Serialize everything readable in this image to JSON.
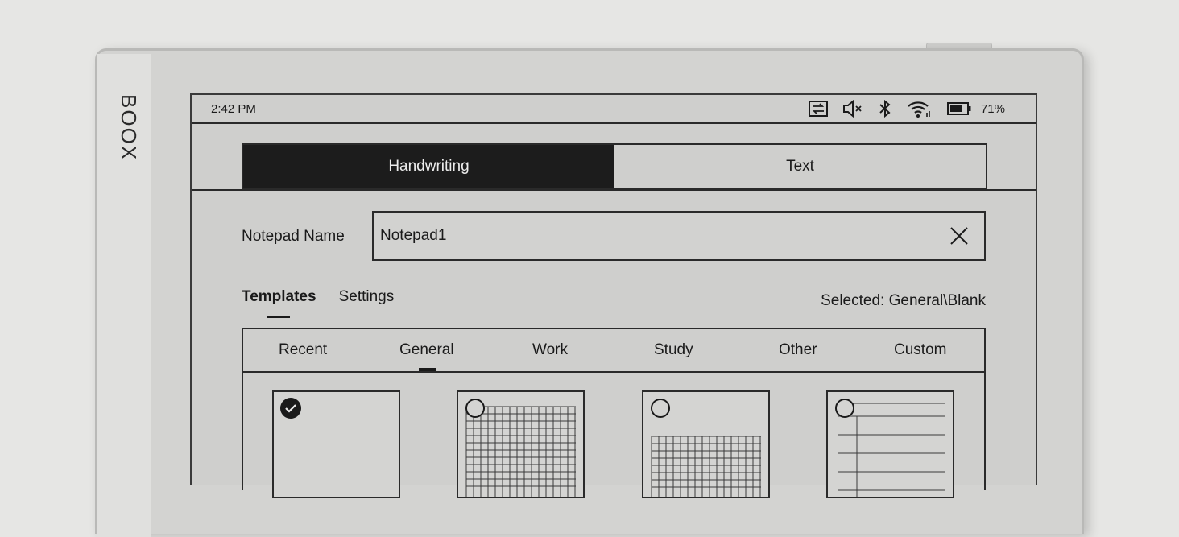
{
  "device": {
    "brand": "BOOX"
  },
  "status_bar": {
    "time": "2:42 PM",
    "icons": [
      "screen-refresh-icon",
      "speaker-muted-icon",
      "bluetooth-icon",
      "wifi-icon",
      "battery-icon"
    ],
    "battery_percent": "71%"
  },
  "mode_tabs": [
    {
      "label": "Handwriting",
      "active": true
    },
    {
      "label": "Text",
      "active": false
    }
  ],
  "notepad": {
    "label": "Notepad Name",
    "value": "Notepad1"
  },
  "sub_tabs": [
    {
      "label": "Templates",
      "active": true
    },
    {
      "label": "Settings",
      "active": false
    }
  ],
  "selected_text": "Selected: General\\Blank",
  "category_tabs": [
    {
      "label": "Recent",
      "active": false
    },
    {
      "label": "General",
      "active": true
    },
    {
      "label": "Work",
      "active": false
    },
    {
      "label": "Study",
      "active": false
    },
    {
      "label": "Other",
      "active": false
    },
    {
      "label": "Custom",
      "active": false
    }
  ],
  "templates": [
    {
      "kind": "blank",
      "selected": true
    },
    {
      "kind": "grid",
      "selected": false
    },
    {
      "kind": "grid-lower",
      "selected": false
    },
    {
      "kind": "lined",
      "selected": false
    }
  ]
}
